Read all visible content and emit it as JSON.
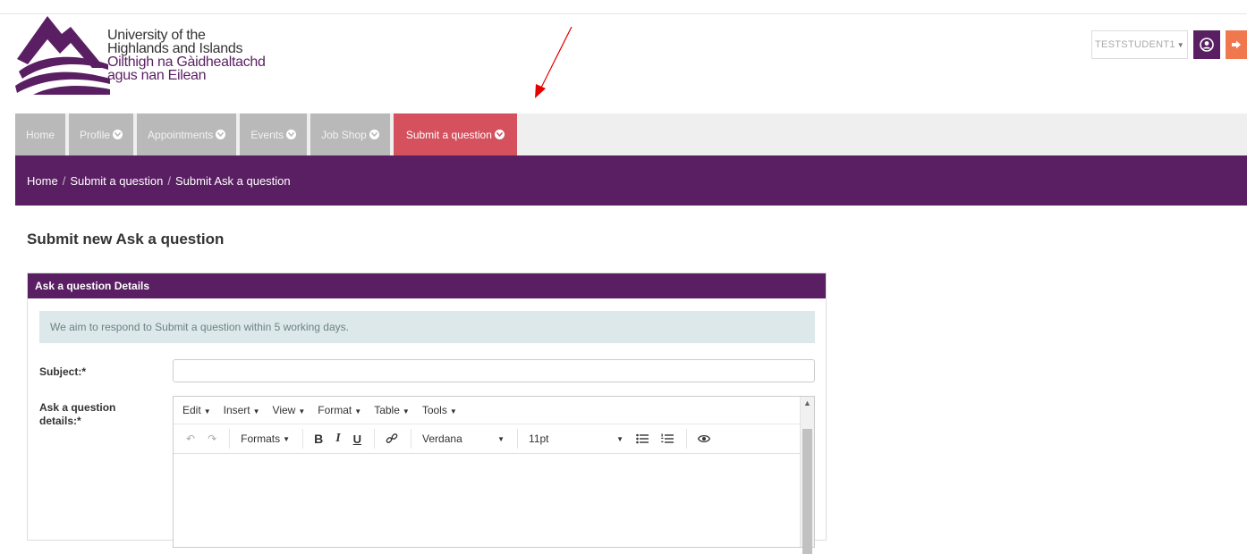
{
  "branding": {
    "line1": "University of the",
    "line2": "Highlands and Islands",
    "line3": "Oilthigh na Gàidhealtachd",
    "line4": "agus nan Eilean"
  },
  "user": {
    "name": "TESTSTUDENT1"
  },
  "nav": {
    "items": [
      {
        "label": "Home"
      },
      {
        "label": "Profile"
      },
      {
        "label": "Appointments"
      },
      {
        "label": "Events"
      },
      {
        "label": "Job Shop"
      },
      {
        "label": "Submit a question"
      }
    ],
    "active_color": "#d4515d"
  },
  "breadcrumb": {
    "items": [
      "Home",
      "Submit a question",
      "Submit Ask a question"
    ],
    "separator": "/"
  },
  "page": {
    "title": "Submit new Ask a question"
  },
  "panel": {
    "heading": "Ask a question Details",
    "info": "We aim to respond to Submit a question within 5 working days.",
    "subject_label": "Subject:*",
    "subject_value": "",
    "details_label_1": "Ask a question",
    "details_label_2": "details:*"
  },
  "editor": {
    "menus": [
      "Edit",
      "Insert",
      "View",
      "Format",
      "Table",
      "Tools"
    ],
    "formats_label": "Formats",
    "bold": "B",
    "italic": "I",
    "underline": "U",
    "font_family": "Verdana",
    "font_size": "11pt"
  },
  "colors": {
    "brand": "#5a1f63",
    "accent": "#f0784f",
    "info_bg": "#dde8ea"
  }
}
